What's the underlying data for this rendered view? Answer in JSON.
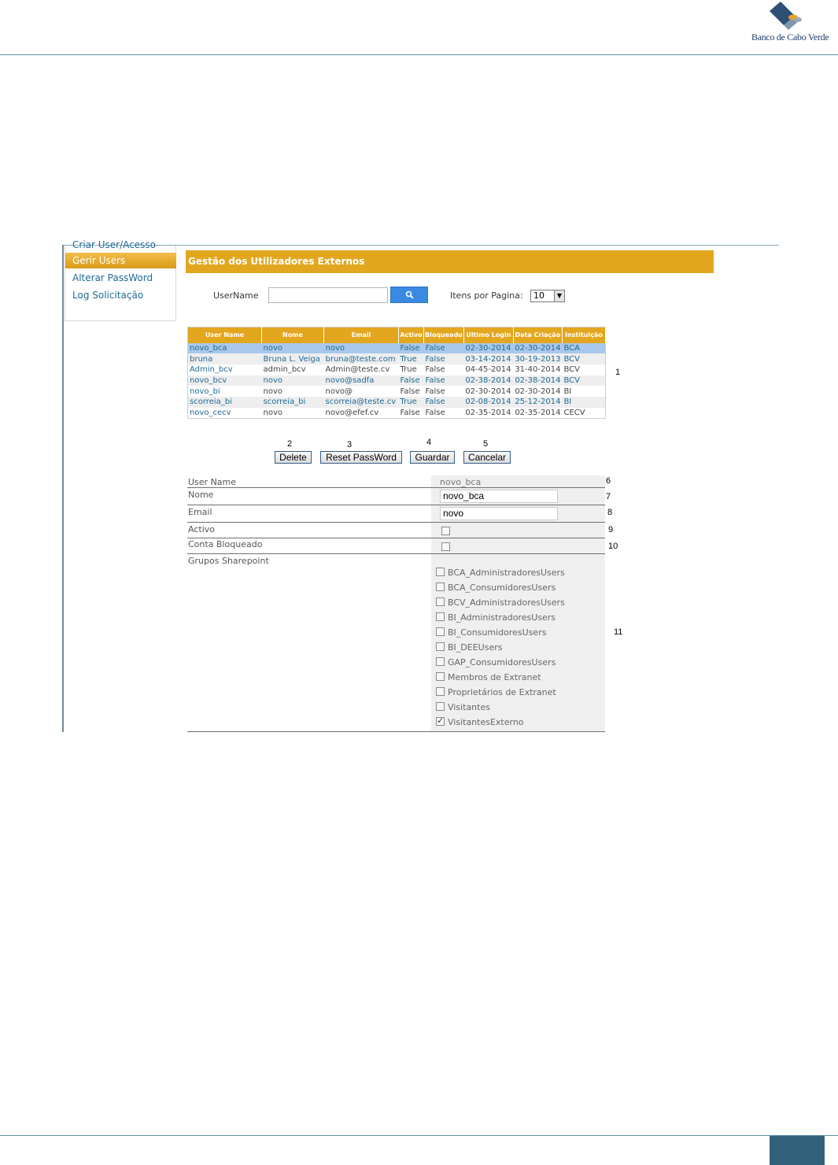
{
  "document": {
    "logo_text": "Banco de Cabo Verde",
    "colors": {
      "rule": "#5f8fa6",
      "page_box": "#31617b",
      "accent": "#e3a71f",
      "link": "#1e6a94",
      "selected_row": "#a9c8eb"
    }
  },
  "sidebar": {
    "clipped_item": "Criar User/Acesso",
    "items": [
      {
        "label": "Gerir Users",
        "active": true
      },
      {
        "label": "Alterar PassWord",
        "active": false
      },
      {
        "label": "Log Solicitação",
        "active": false
      }
    ]
  },
  "main": {
    "title": "Gestão dos Utilizadores Externos",
    "search": {
      "label": "UserName",
      "value": "",
      "button_icon": "search-icon"
    },
    "items_per_page": {
      "label": "Itens por Pagina:",
      "selected": "10"
    }
  },
  "grid": {
    "columns": [
      "User Name",
      "Nome",
      "Email",
      "Activo",
      "Bloqueado",
      "Ultimo Login",
      "Data Criação",
      "Instituição"
    ],
    "rows": [
      [
        "novo_bca",
        "novo",
        "novo",
        "False",
        "False",
        "02-30-2014",
        "02-30-2014",
        "BCA"
      ],
      [
        "bruna",
        "Bruna L. Veiga",
        "bruna@teste.com",
        "True",
        "False",
        "03-14-2014",
        "30-19-2013",
        "BCV"
      ],
      [
        "Admin_bcv",
        "admin_bcv",
        "Admin@teste.cv",
        "True",
        "False",
        "04-45-2014",
        "31-40-2014",
        "BCV"
      ],
      [
        "novo_bcv",
        "novo",
        "novo@sadfa",
        "False",
        "False",
        "02-38-2014",
        "02-38-2014",
        "BCV"
      ],
      [
        "novo_bi",
        "novo",
        "novo@",
        "False",
        "False",
        "02-30-2014",
        "02-30-2014",
        "BI"
      ],
      [
        "scorreia_bi",
        "scorreia_bi",
        "scorreia@teste.cv",
        "True",
        "False",
        "02-08-2014",
        "25-12-2014",
        "BI"
      ],
      [
        "novo_cecv",
        "novo",
        "novo@efef.cv",
        "False",
        "False",
        "02-35-2014",
        "02-35-2014",
        "CECV"
      ]
    ]
  },
  "actions": {
    "delete": "Delete",
    "reset_password": "Reset PassWord",
    "save": "Guardar",
    "cancel": "Cancelar"
  },
  "form": {
    "user_name_label": "User Name",
    "user_name_value": "novo_bca",
    "nome_label": "Nome",
    "nome_value": "novo_bca",
    "email_label": "Email",
    "email_value": "novo",
    "activo_label": "Activo",
    "activo_checked": false,
    "bloqueado_label": "Conta Bloqueado",
    "bloqueado_checked": false,
    "grupos_label": "Grupos Sharepoint",
    "groups": [
      {
        "name": "BCA_AdministradoresUsers",
        "checked": false
      },
      {
        "name": "BCA_ConsumidoresUsers",
        "checked": false
      },
      {
        "name": "BCV_AdministradoresUsers",
        "checked": false
      },
      {
        "name": "BI_AdministradoresUsers",
        "checked": false
      },
      {
        "name": "BI_ConsumidoresUsers",
        "checked": false
      },
      {
        "name": "BI_DEEUsers",
        "checked": false
      },
      {
        "name": "GAP_ConsumidoresUsers",
        "checked": false
      },
      {
        "name": "Membros de Extranet",
        "checked": false
      },
      {
        "name": "Proprietários de Extranet",
        "checked": false
      },
      {
        "name": "Visitantes",
        "checked": false
      },
      {
        "name": "VisitantesExterno",
        "checked": true
      }
    ]
  },
  "callouts": [
    "1",
    "2",
    "3",
    "4",
    "5",
    "6",
    "7",
    "8",
    "9",
    "10",
    "11"
  ]
}
